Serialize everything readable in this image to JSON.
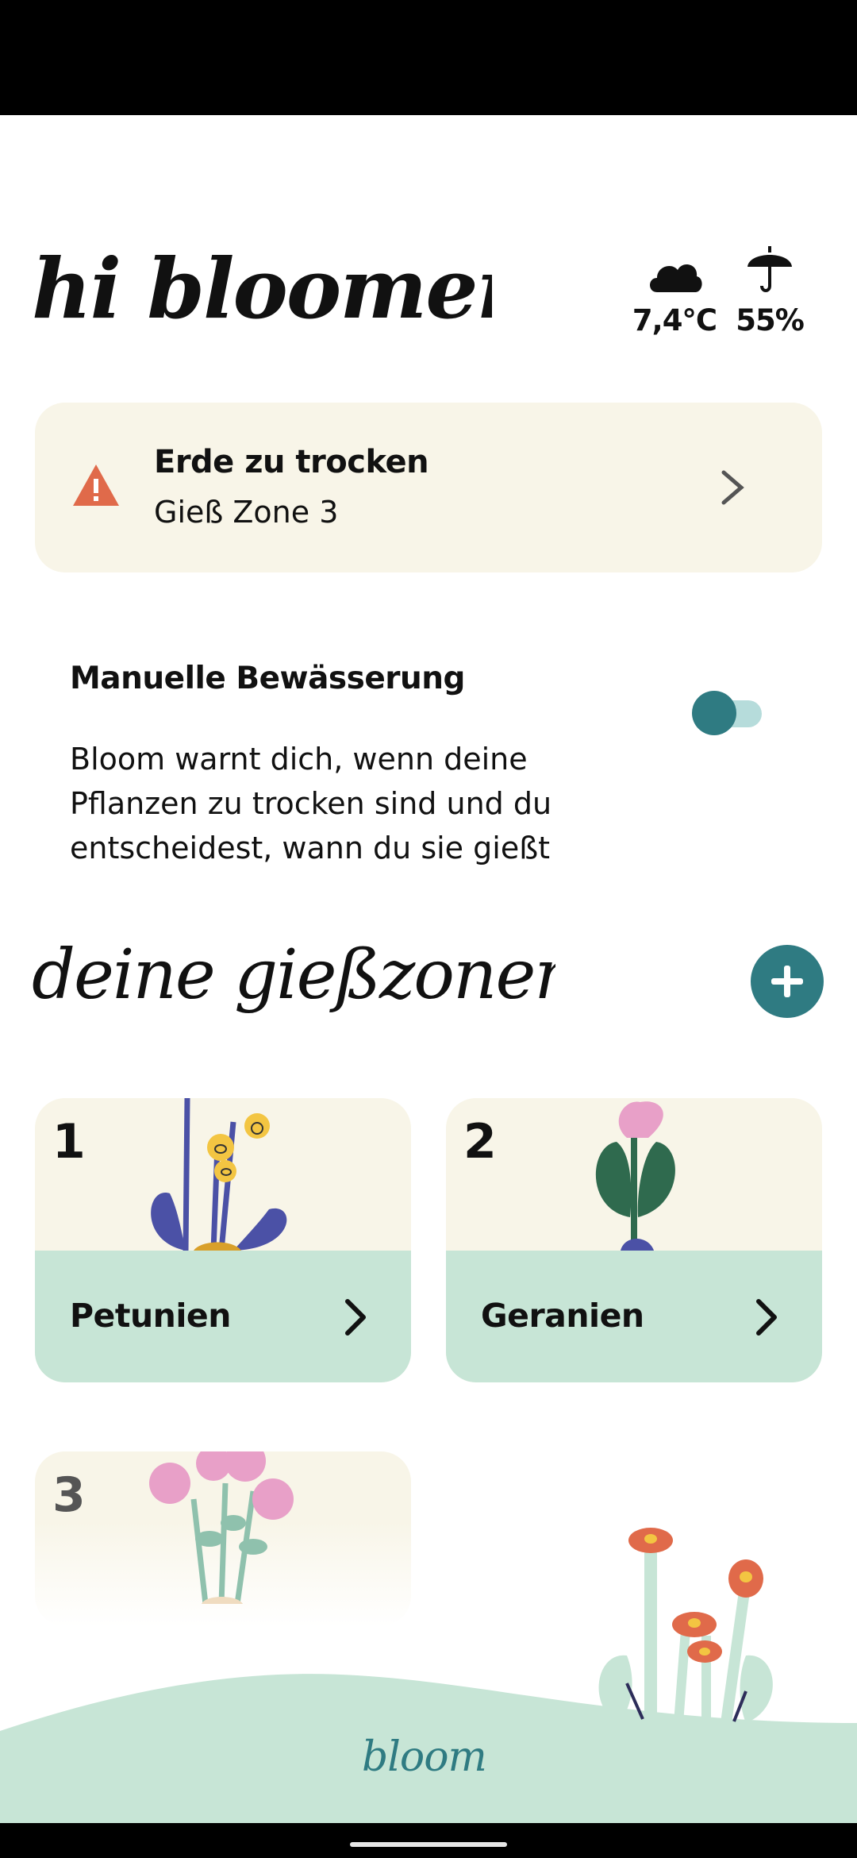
{
  "header": {
    "greeting": "hi bloomer",
    "weather": {
      "temperature": "7,4°C",
      "rain_chance": "55%"
    }
  },
  "alert": {
    "title": "Erde zu trocken",
    "subtitle": "Gieß Zone 3",
    "color": "#e06a4a"
  },
  "manual_watering": {
    "title": "Manuelle Bewässerung",
    "description": "Bloom warnt dich, wenn deine Pflanzen zu trocken sind und du entscheidest, wann du sie gießt",
    "enabled": false
  },
  "zones": {
    "title": "deine gießzonen",
    "items": [
      {
        "number": "1",
        "name": "Petunien"
      },
      {
        "number": "2",
        "name": "Geranien"
      },
      {
        "number": "3",
        "name": ""
      }
    ]
  },
  "footer": {
    "brand": "bloom"
  },
  "colors": {
    "accent": "#2f7b82",
    "card_bg": "#f8f5e8",
    "mint": "#c7e5d6"
  }
}
